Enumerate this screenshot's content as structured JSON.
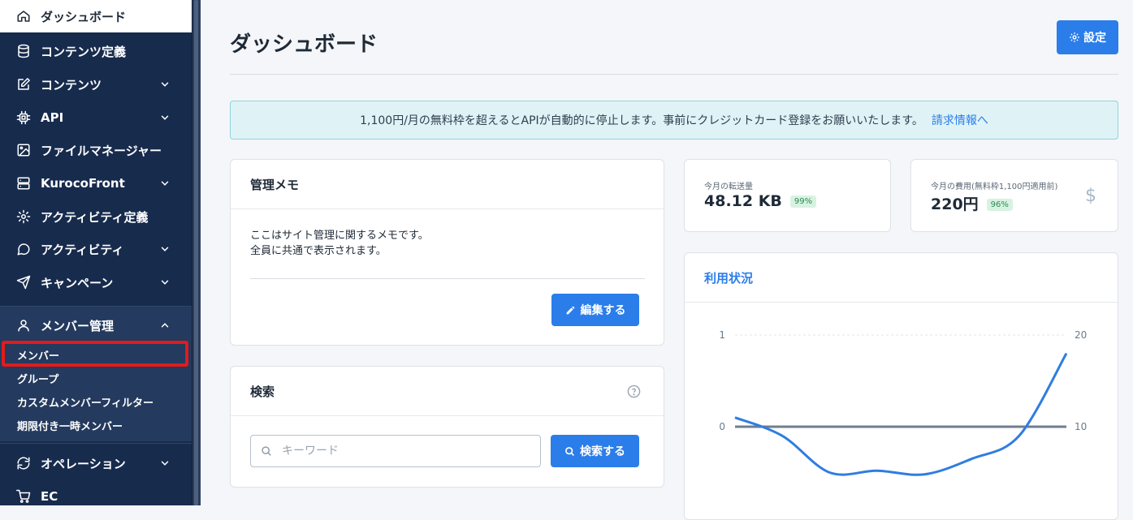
{
  "sidebar": {
    "items": [
      {
        "label": "ダッシュボード",
        "icon": "home-icon",
        "active": true
      },
      {
        "label": "コンテンツ定義",
        "icon": "database-icon"
      },
      {
        "label": "コンテンツ",
        "icon": "edit-icon",
        "chevron": "down"
      },
      {
        "label": "API",
        "icon": "chip-icon",
        "chevron": "down"
      },
      {
        "label": "ファイルマネージャー",
        "icon": "image-icon"
      },
      {
        "label": "KurocoFront",
        "icon": "server-icon",
        "chevron": "down"
      },
      {
        "label": "アクティビティ定義",
        "icon": "gear-icon"
      },
      {
        "label": "アクティビティ",
        "icon": "chat-icon",
        "chevron": "down"
      },
      {
        "label": "キャンペーン",
        "icon": "send-icon",
        "chevron": "down"
      },
      {
        "label": "メンバー管理",
        "icon": "user-icon",
        "chevron": "up"
      },
      {
        "label": "オペレーション",
        "icon": "refresh-icon",
        "chevron": "down"
      },
      {
        "label": "EC",
        "icon": "cart-icon"
      }
    ],
    "member_sub": [
      "メンバー",
      "グループ",
      "カスタムメンバーフィルター",
      "期限付き一時メンバー"
    ]
  },
  "header": {
    "title": "ダッシュボード",
    "settings_label": "設定"
  },
  "alert": {
    "text": "1,100円/月の無料枠を超えるとAPIが自動的に停止します。事前にクレジットカード登録をお願いいたします。",
    "link": "請求情報へ"
  },
  "memo": {
    "title": "管理メモ",
    "line1": "ここはサイト管理に関するメモです。",
    "line2": "全員に共通で表示されます。",
    "edit_label": "編集する"
  },
  "search": {
    "title": "検索",
    "placeholder": "キーワード",
    "button_label": "検索する"
  },
  "transfer": {
    "label": "今月の転送量",
    "value": "48.12 KB",
    "badge": "99%"
  },
  "cost": {
    "label": "今月の費用(無料枠1,100円適用前)",
    "value": "220円",
    "badge": "96%"
  },
  "usage": {
    "title": "利用状況"
  },
  "chart_data": {
    "type": "line",
    "left_axis": {
      "ticks": [
        "1",
        "0"
      ],
      "ylim": [
        0,
        1
      ]
    },
    "right_axis": {
      "ticks": [
        "20",
        "10"
      ],
      "ylim": [
        10,
        20
      ]
    },
    "series": [
      {
        "axis": "left",
        "values": [
          0,
          0,
          0,
          0,
          0,
          0,
          0,
          0
        ],
        "color": "#6f7e90"
      },
      {
        "axis": "right",
        "values": [
          11.0,
          9.0,
          5.0,
          5.2,
          4.8,
          6.5,
          9.0,
          18.0
        ],
        "color": "#2f7de1"
      }
    ]
  },
  "colors": {
    "sidebar_bg": "#172b4d",
    "accent": "#2b7de9",
    "highlight": "#e11b1b"
  }
}
